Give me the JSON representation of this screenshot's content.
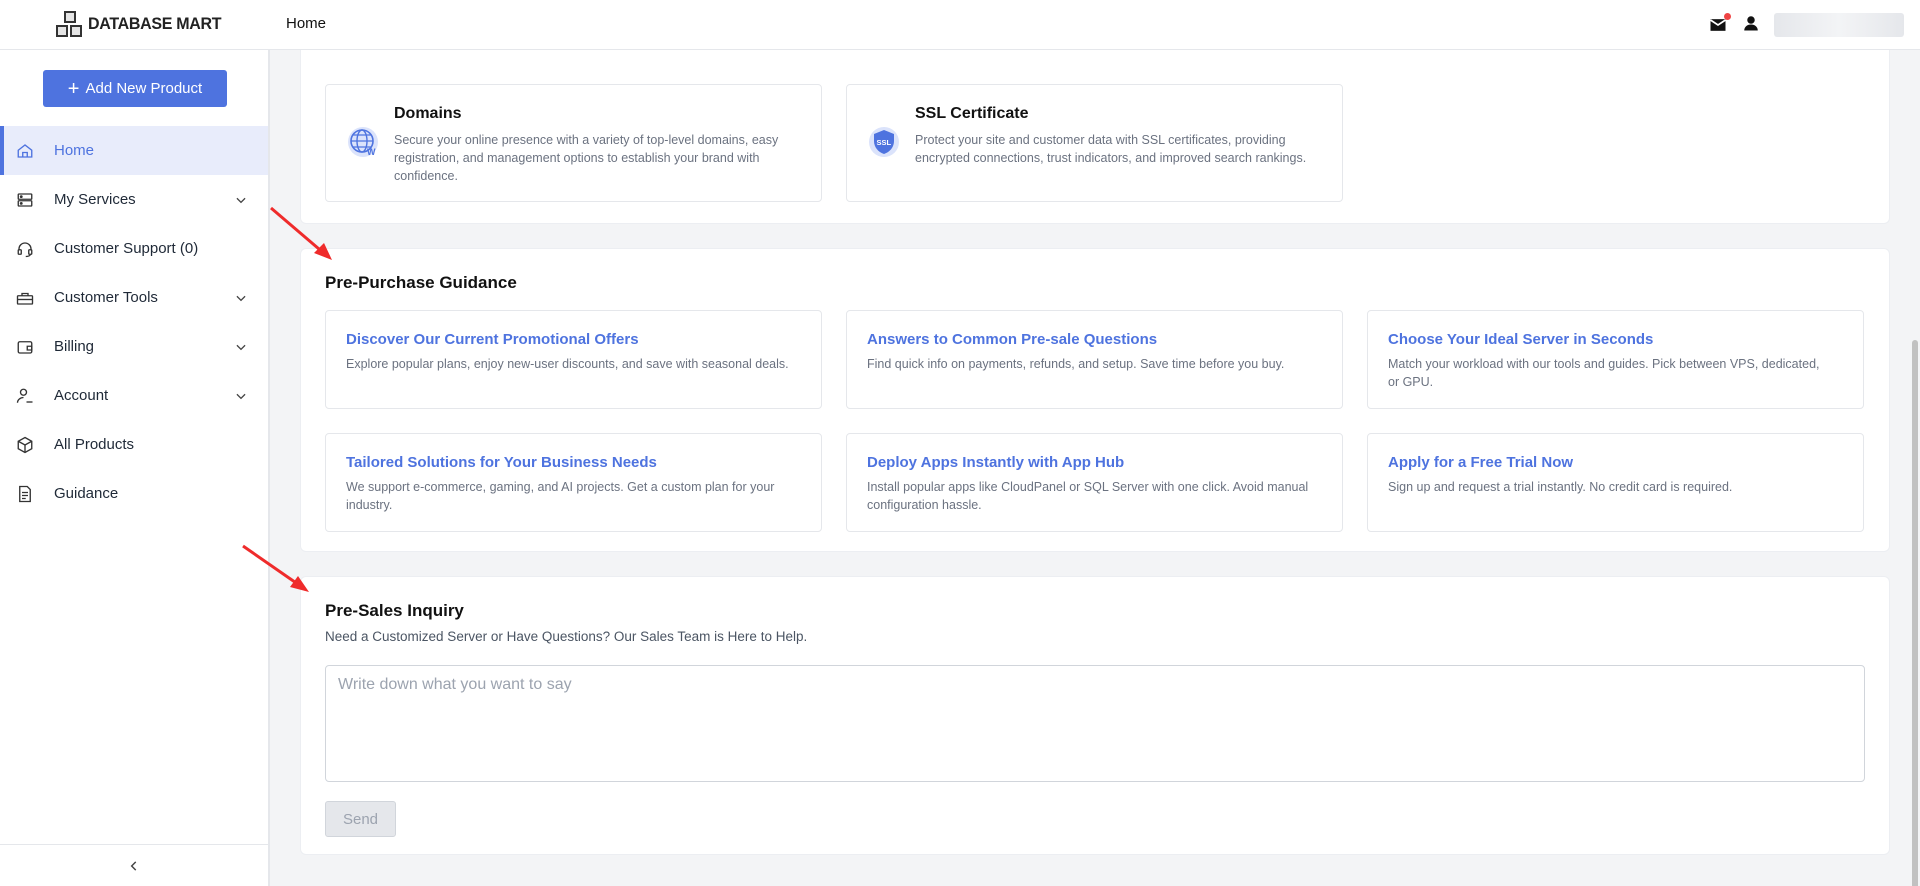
{
  "header": {
    "logo_text": "DATABASE MART",
    "title": "Home",
    "icons": [
      "mail-icon",
      "user-icon"
    ]
  },
  "sidebar": {
    "add_button": "Add New Product",
    "items": [
      {
        "label": "Home",
        "icon": "home-icon",
        "active": true,
        "expandable": false
      },
      {
        "label": "My Services",
        "icon": "server-icon",
        "expandable": true
      },
      {
        "label": "Customer Support (0)",
        "icon": "headset-icon",
        "expandable": false
      },
      {
        "label": "Customer Tools",
        "icon": "toolbox-icon",
        "expandable": true
      },
      {
        "label": "Billing",
        "icon": "wallet-icon",
        "expandable": true
      },
      {
        "label": "Account",
        "icon": "user-settings-icon",
        "expandable": true
      },
      {
        "label": "All Products",
        "icon": "box-icon",
        "expandable": false
      },
      {
        "label": "Guidance",
        "icon": "document-icon",
        "expandable": false
      }
    ]
  },
  "services": [
    {
      "title": "Domains",
      "icon": "globe-icon",
      "desc": "Secure your online presence with a variety of top-level domains, easy registration, and management options to establish your brand with confidence."
    },
    {
      "title": "SSL Certificate",
      "icon": "ssl-shield-icon",
      "desc": "Protect your site and customer data with SSL certificates, providing encrypted connections, trust indicators, and improved search rankings."
    }
  ],
  "guidance": {
    "title": "Pre-Purchase Guidance",
    "items": [
      {
        "title": "Discover Our Current Promotional Offers",
        "desc": "Explore popular plans, enjoy new-user discounts, and save with seasonal deals."
      },
      {
        "title": "Answers to Common Pre-sale Questions",
        "desc": "Find quick info on payments, refunds, and setup. Save time before you buy."
      },
      {
        "title": "Choose Your Ideal Server in Seconds",
        "desc": "Match your workload with our tools and guides. Pick between VPS, dedicated, or GPU."
      },
      {
        "title": "Tailored Solutions for Your Business Needs",
        "desc": "We support e-commerce, gaming, and AI projects. Get a custom plan for your industry."
      },
      {
        "title": "Deploy Apps Instantly with App Hub",
        "desc": "Install popular apps like CloudPanel or SQL Server with one click. Avoid manual configuration hassle."
      },
      {
        "title": "Apply for a Free Trial Now",
        "desc": "Sign up and request a trial instantly. No credit card is required."
      }
    ]
  },
  "inquiry": {
    "title": "Pre-Sales Inquiry",
    "subtitle": "Need a Customized Server or Have Questions? Our Sales Team is Here to Help.",
    "placeholder": "Write down what you want to say",
    "send_label": "Send"
  },
  "colors": {
    "accent": "#4e73df",
    "annotation_arrow": "#ef2b2b"
  }
}
